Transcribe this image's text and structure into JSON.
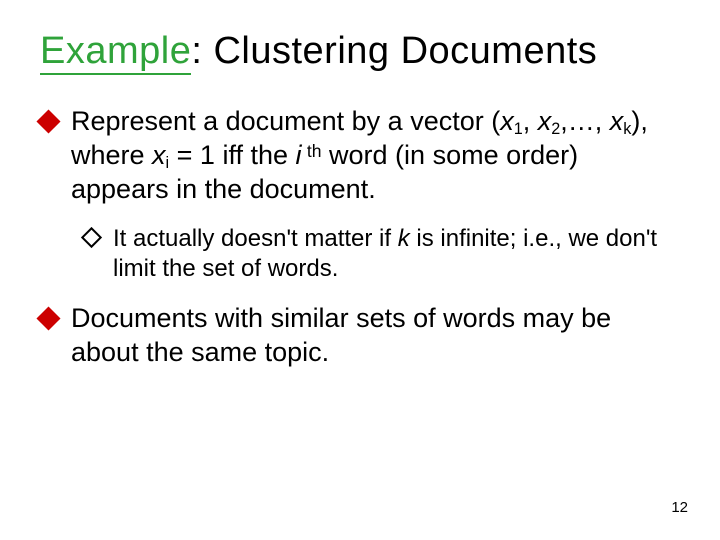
{
  "title": {
    "keyword": "Example",
    "rest": ": Clustering Documents"
  },
  "bullets": {
    "b1": {
      "p1": "Represent a document by a vector (",
      "x": "x",
      "s1": "1",
      "c": ", ",
      "s2": "2",
      "dots": ",…, ",
      "sk": "k",
      "p2": "), where ",
      "xi": "x",
      "si": "i",
      "eq": " = 1 iff the ",
      "ivar": "i ",
      "th": "th",
      "p3": " word (in some order) appears in the document."
    },
    "sub1": {
      "p1": "It actually doesn't matter if ",
      "kvar": "k ",
      "p2": " is infinite; i.e., we don't limit the set of words."
    },
    "b2": "Documents with similar sets of words may be about the same topic."
  },
  "page": "12"
}
